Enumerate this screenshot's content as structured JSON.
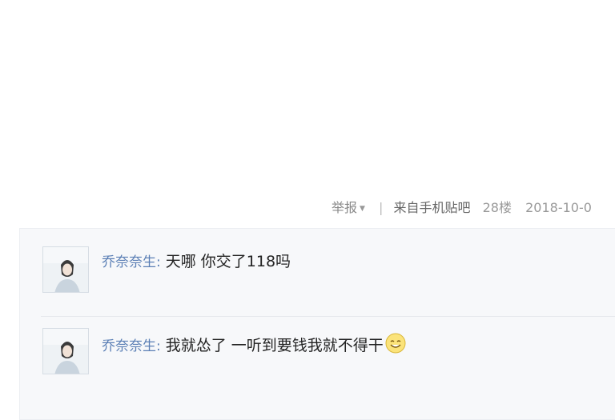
{
  "post_meta": {
    "report_label": "举报",
    "separator": "|",
    "source": "来自手机贴吧",
    "floor": "28楼",
    "date": "2018-10-0"
  },
  "replies": [
    {
      "username": "乔奈奈生:",
      "content": "天哪 你交了118吗",
      "avatar_icon": "user-avatar-photo"
    },
    {
      "username": "乔奈奈生:",
      "content": "我就怂了 一听到要钱我就不得干",
      "emoji": "smiley-emoji-icon",
      "avatar_icon": "user-avatar-photo"
    }
  ],
  "colors": {
    "username": "#5b7fb5",
    "meta": "#999999",
    "reply_bg": "#f7f8fa"
  }
}
